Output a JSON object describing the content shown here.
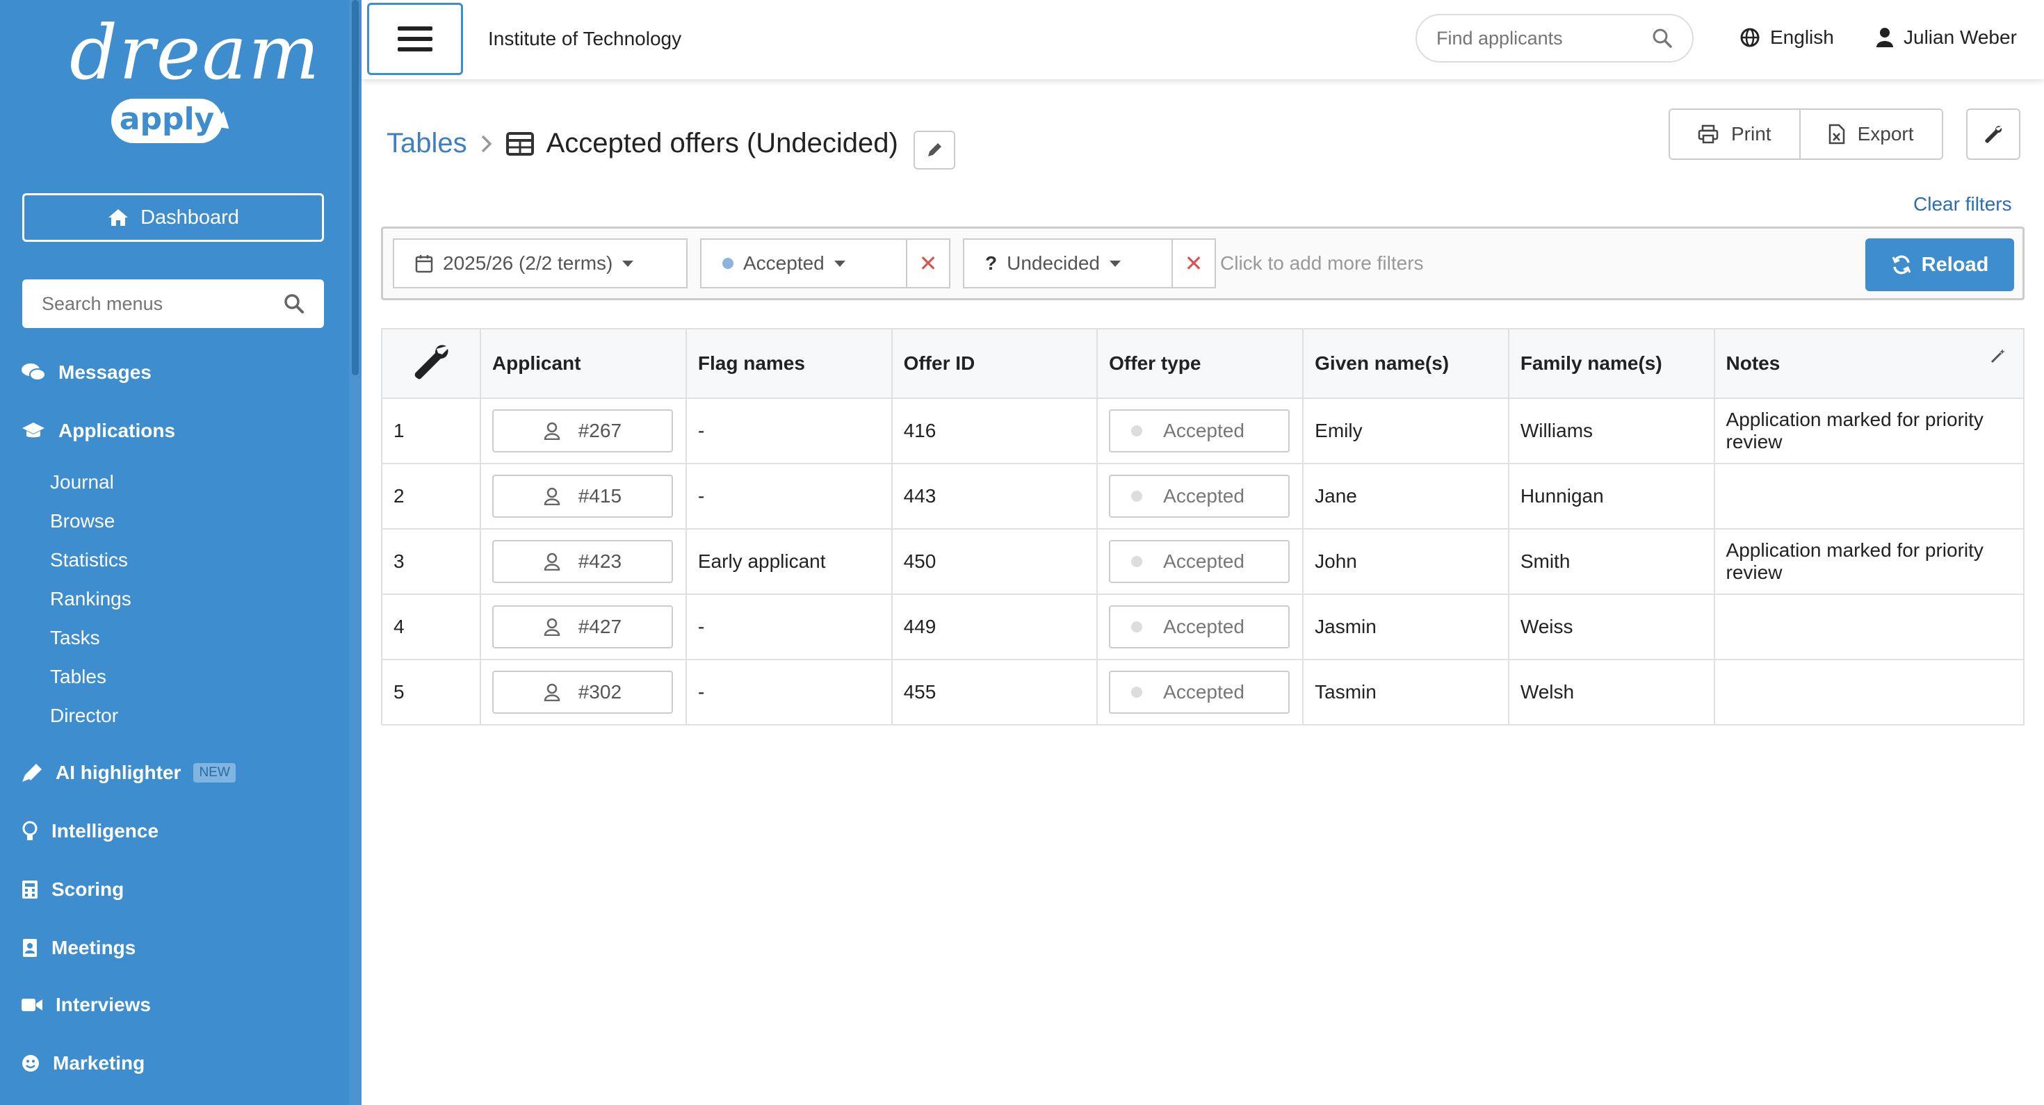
{
  "sidebar": {
    "logo_top": "dream",
    "logo_bottom": "apply",
    "dashboard_label": "Dashboard",
    "search_placeholder": "Search menus",
    "messages": "Messages",
    "applications": "Applications",
    "applications_items": [
      "Journal",
      "Browse",
      "Statistics",
      "Rankings",
      "Tasks",
      "Tables",
      "Director"
    ],
    "ai_highlighter": "AI highlighter",
    "new_badge": "NEW",
    "intelligence": "Intelligence",
    "scoring": "Scoring",
    "meetings": "Meetings",
    "interviews": "Interviews",
    "marketing": "Marketing"
  },
  "topbar": {
    "institution": "Institute of Technology",
    "find_placeholder": "Find applicants",
    "language": "English",
    "user": "Julian Weber"
  },
  "breadcrumb": {
    "parent": "Tables",
    "title": "Accepted offers (Undecided)"
  },
  "actions": {
    "print": "Print",
    "export": "Export",
    "clear_filters": "Clear filters"
  },
  "filters": {
    "term": "2025/26 (2/2 terms)",
    "status": "Accepted",
    "decision": "Undecided",
    "add_more": "Click to add more filters",
    "reload": "Reload"
  },
  "table": {
    "headers": [
      "Applicant",
      "Flag names",
      "Offer ID",
      "Offer type",
      "Given name(s)",
      "Family name(s)",
      "Notes"
    ],
    "rows": [
      {
        "n": "1",
        "applicant": "#267",
        "flag": "-",
        "offer_id": "416",
        "offer_type": "Accepted",
        "given": "Emily",
        "family": "Williams",
        "notes": "Application marked for priority review"
      },
      {
        "n": "2",
        "applicant": "#415",
        "flag": "-",
        "offer_id": "443",
        "offer_type": "Accepted",
        "given": "Jane",
        "family": "Hunnigan",
        "notes": ""
      },
      {
        "n": "3",
        "applicant": "#423",
        "flag": "Early applicant",
        "offer_id": "450",
        "offer_type": "Accepted",
        "given": "John",
        "family": "Smith",
        "notes": "Application marked for priority review"
      },
      {
        "n": "4",
        "applicant": "#427",
        "flag": "-",
        "offer_id": "449",
        "offer_type": "Accepted",
        "given": "Jasmin",
        "family": "Weiss",
        "notes": ""
      },
      {
        "n": "5",
        "applicant": "#302",
        "flag": "-",
        "offer_id": "455",
        "offer_type": "Accepted",
        "given": "Tasmin",
        "family": "Welsh",
        "notes": ""
      }
    ]
  },
  "colors": {
    "sidebar": "#3d8dcf",
    "accent": "#3d8dcf",
    "link": "#3d7fc1",
    "remove": "#d9534f"
  }
}
